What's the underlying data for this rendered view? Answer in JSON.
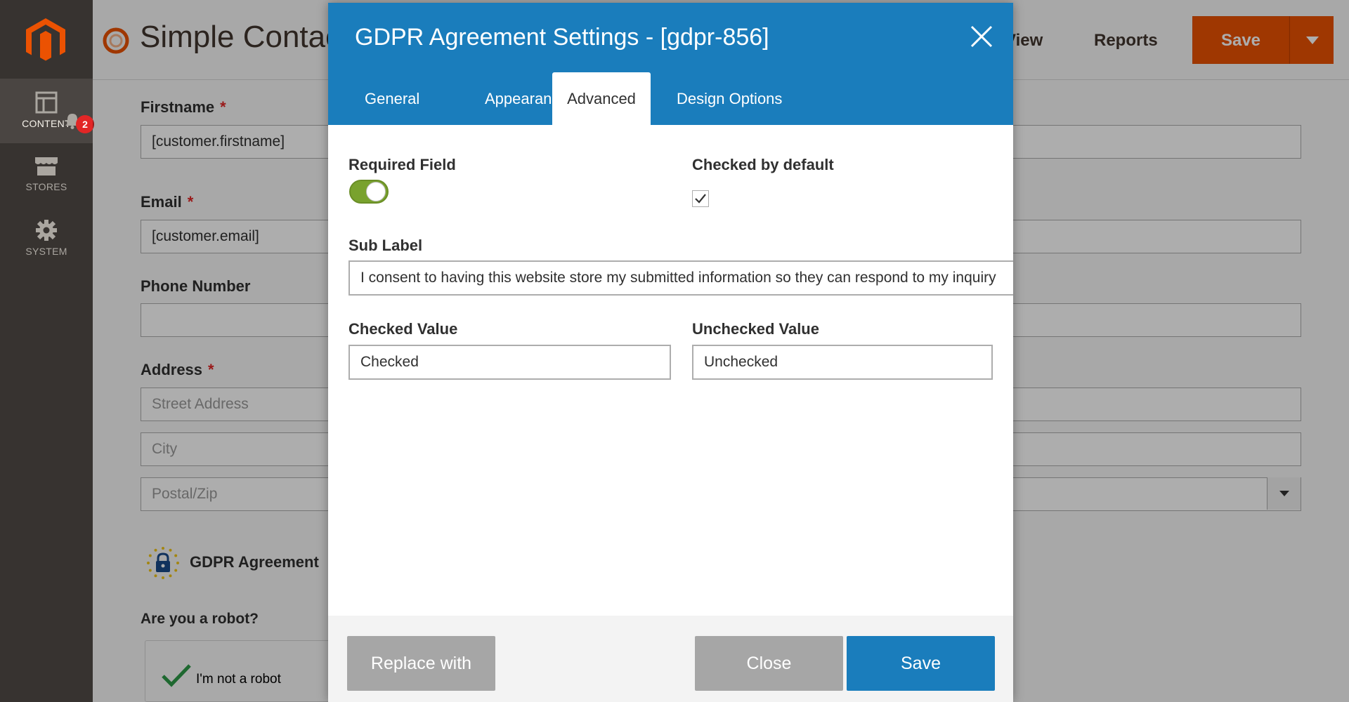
{
  "sidebar": {
    "items": [
      {
        "label": "CONTENT",
        "icon": "content-icon",
        "active": true
      },
      {
        "label": "STORES",
        "icon": "stores-icon",
        "active": false
      },
      {
        "label": "SYSTEM",
        "icon": "gear-icon",
        "active": false
      }
    ],
    "notification_count": "2"
  },
  "header": {
    "title": "Simple Contact",
    "view_label": "View",
    "reports_label": "Reports",
    "save_label": "Save"
  },
  "form": {
    "firstname_label": "Firstname",
    "firstname_value": "[customer.firstname]",
    "email_label": "Email",
    "email_value": "[customer.email]",
    "phone_label": "Phone Number",
    "address_label": "Address",
    "street_placeholder": "Street Address",
    "city_placeholder": "City",
    "postal_placeholder": "Postal/Zip",
    "gdpr_label": "GDPR Agreement",
    "robot_label": "Are you a robot?",
    "captcha_text": "I'm not a robot",
    "required_mark": "*"
  },
  "modal": {
    "title": "GDPR Agreement Settings - [gdpr-856]",
    "tabs": [
      "General",
      "Appearance",
      "Advanced",
      "Design Options"
    ],
    "active_tab": "Advanced",
    "required_field_label": "Required Field",
    "required_field_on": true,
    "checked_by_default_label": "Checked by default",
    "checked_by_default": true,
    "sub_label_label": "Sub Label",
    "sub_label_value": "I consent to having this website store my submitted information so they can respond to my inquiry",
    "checked_value_label": "Checked Value",
    "checked_value": "Checked",
    "unchecked_value_label": "Unchecked Value",
    "unchecked_value": "Unchecked",
    "replace_label": "Replace with",
    "close_label": "Close",
    "save_label": "Save"
  },
  "colors": {
    "accent": "#1a7dbc",
    "brand_orange": "#eb5202",
    "toggle_on": "#79a22e",
    "sidebar_bg": "#373330"
  }
}
